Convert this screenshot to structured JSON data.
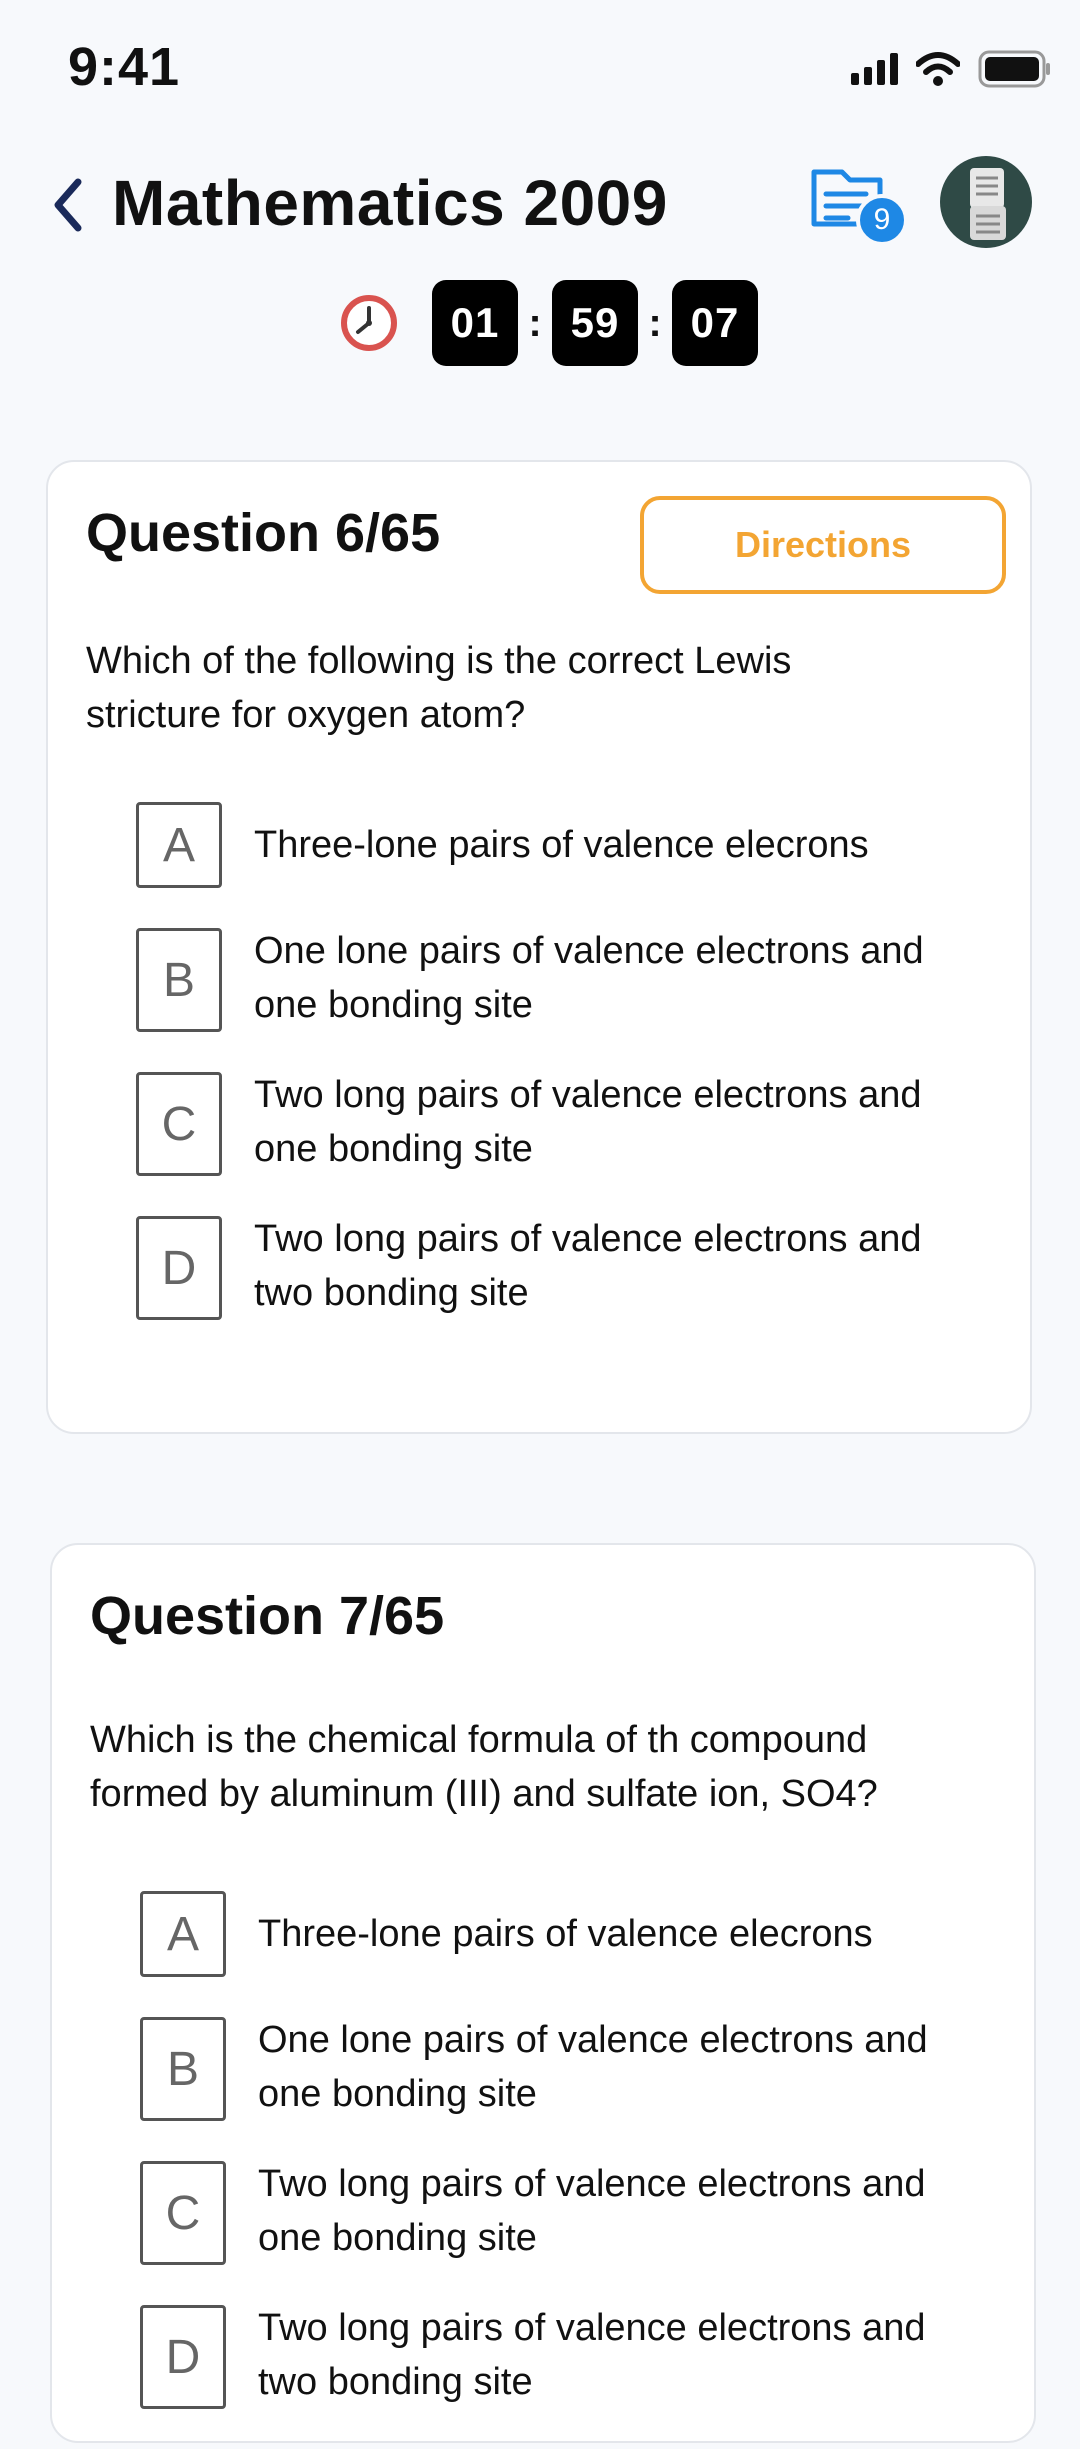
{
  "status_bar": {
    "time": "9:41",
    "icons": [
      "signal-icon",
      "wifi-icon",
      "battery-icon"
    ]
  },
  "header": {
    "title": "Mathematics 2009",
    "badge_count": "9",
    "icons": [
      "back-icon",
      "documents-icon",
      "avatar"
    ]
  },
  "timer": {
    "hours": "01",
    "minutes": "59",
    "seconds": "07",
    "separator": ":"
  },
  "questions": [
    {
      "title": "Question 6/65",
      "directions_label": "Directions",
      "text": "Which of the following is the correct Lewis\n stricture for oxygen atom?",
      "options": [
        {
          "letter": "A",
          "text": "Three-lone pairs of valence elecrons"
        },
        {
          "letter": "B",
          "text": "One lone pairs of valence electrons and one bonding site"
        },
        {
          "letter": "C",
          "text": "Two long pairs of valence electrons and one bonding site"
        },
        {
          "letter": "D",
          "text": "Two long pairs of valence electrons and two bonding site"
        }
      ]
    },
    {
      "title": "Question 7/65",
      "text": "Which is the chemical formula of th compound formed by aluminum (III) and sulfate ion, SO4?",
      "options": [
        {
          "letter": "A",
          "text": "Three-lone pairs of valence elecrons"
        },
        {
          "letter": "B",
          "text": "One lone pairs of valence electrons and one bonding site"
        },
        {
          "letter": "C",
          "text": "Two long pairs of valence electrons and one bonding site"
        },
        {
          "letter": "D",
          "text": "Two long pairs of valence electrons and two bonding site"
        }
      ]
    }
  ],
  "colors": {
    "accent_orange": "#F3A533",
    "badge_blue": "#1E88E5",
    "background": "#F7F9FC"
  }
}
